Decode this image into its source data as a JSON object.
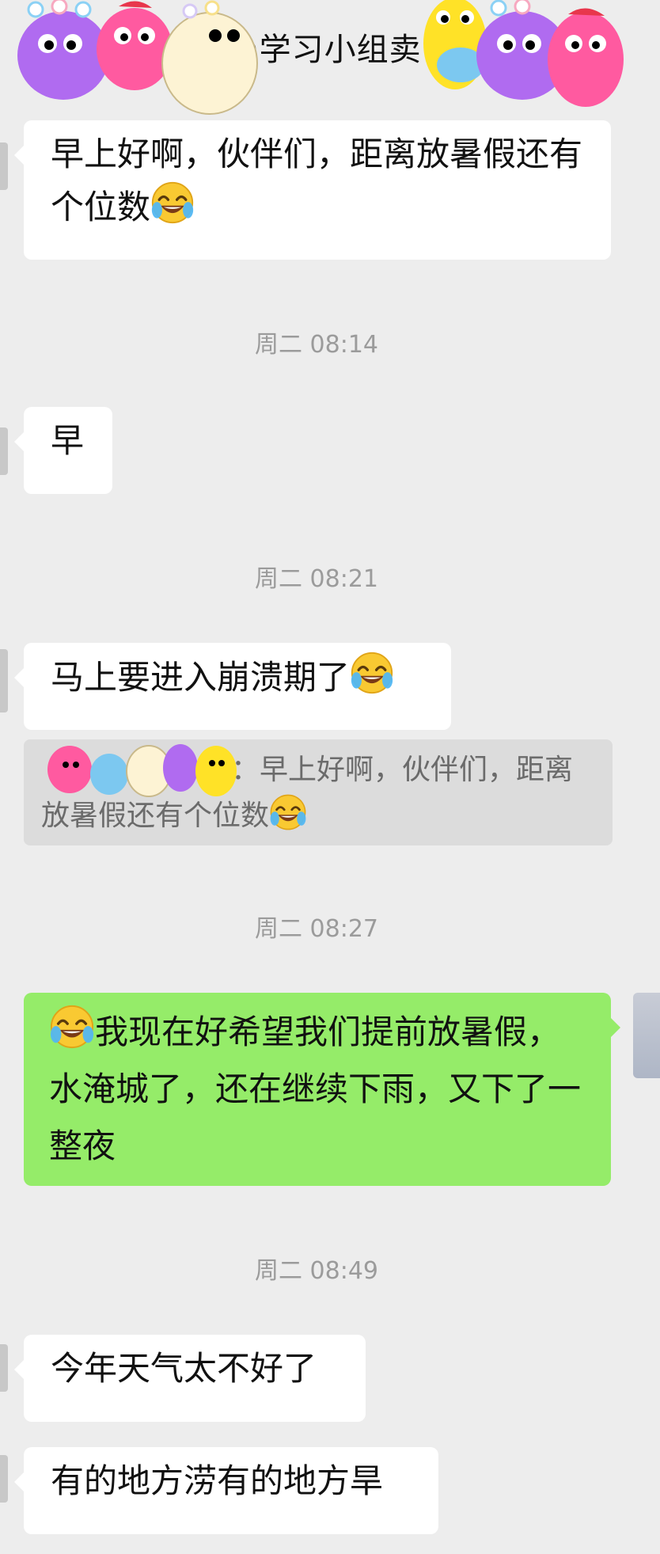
{
  "header": {
    "title": "n学习小组卖"
  },
  "messages": [
    {
      "text": "早上好啊，伙伴们，距离放暑假还有个位数"
    },
    {
      "time": "周二 08:14",
      "text": "早"
    },
    {
      "time": "周二 08:21",
      "text": "马上要进入崩溃期了"
    },
    {
      "quote": {
        "text": "：早上好啊，伙伴们，距离放暑假还有个位数"
      }
    },
    {
      "time": "周二 08:27",
      "text": "我现在好希望我们提前放暑假，水淹城了，还在继续下雨，又下了一整夜"
    },
    {
      "time": "周二 08:49",
      "text": "今年天气太不好了"
    },
    {
      "text": "有的地方涝有的地方旱"
    }
  ],
  "emoji": "laughing-tears-emoji",
  "colors": {
    "background": "#ededed",
    "bubble": "#ffffff",
    "self_bubble": "#95ec69",
    "time": "#9b9b9b"
  }
}
